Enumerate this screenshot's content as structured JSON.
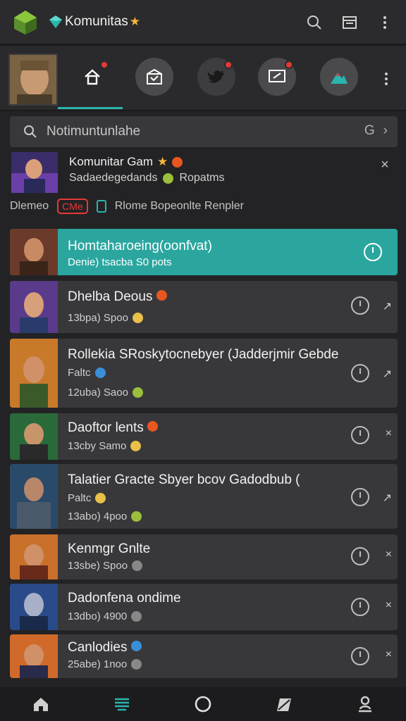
{
  "app": {
    "title": "Komunitas"
  },
  "search": {
    "placeholder": "Notimuntunlahe",
    "right_glyph": "G"
  },
  "notification": {
    "title": "Komunitar Gam",
    "subtitle": "Sadaedegedands",
    "subtitle_tag": "Ropatms",
    "meta_label": "Dlemeo",
    "meta_badge": "CMe",
    "meta_text": "Rlome Bopeonlte Renpler"
  },
  "items": [
    {
      "title": "Homtaharoeing(oonfvat)",
      "sub": "Denie) tsacba S0 pots",
      "emoji": ""
    },
    {
      "title": "Dhelba Deous",
      "sub": "13bpa) Spoo",
      "emoji": "yellow"
    },
    {
      "title": "Rollekia SRoskytocnebyer (Jadderjmir Gebde",
      "sub": "Faltc",
      "sub2": "12uba) Saoo",
      "emoji": "green"
    },
    {
      "title": "Daoftor lents",
      "sub": "13cby Samo",
      "emoji": "yellow"
    },
    {
      "title": "Talatier Gracte Sbyer bcov Gadodbub (",
      "sub": "Paltc",
      "sub2": "13abo) 4poo",
      "emoji": "green"
    },
    {
      "title": "Kenmgr Gnlte",
      "sub": "13sbe) Spoo",
      "emoji": "gray"
    },
    {
      "title": "Dadonfena ondime",
      "sub": "13dbo) 4900",
      "emoji": "gray"
    },
    {
      "title": "Canlodies",
      "sub": "25abe) 1noo",
      "emoji": "gray"
    }
  ],
  "colors": {
    "accent": "#2bb5ad",
    "badge_red": "#e53935",
    "background": "#232325",
    "card": "#38383b"
  },
  "icons": {
    "top": [
      "search-icon",
      "layout-icon",
      "more-vertical-icon"
    ],
    "nav": [
      "home-icon",
      "mail-icon",
      "twitter-icon",
      "edit-screen-icon",
      "mountain-icon"
    ],
    "bottom": [
      "home-icon",
      "feed-icon",
      "circle-icon",
      "flag-icon",
      "profile-icon"
    ]
  }
}
